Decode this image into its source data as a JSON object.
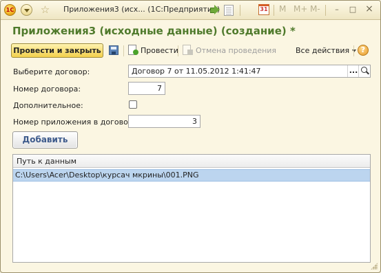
{
  "window": {
    "title": "Приложения3 (исх...  (1С:Предприятие)",
    "logo_text": "1С",
    "calendar_text": "31",
    "memory_buttons": [
      "M",
      "M+",
      "M-"
    ],
    "controls": {
      "minimize": "–",
      "restore": "□",
      "close": "×"
    }
  },
  "form": {
    "title": "Приложения3 (исходные данные) (создание) *"
  },
  "toolbar": {
    "post_and_close": "Провести и закрыть",
    "post": "Провести",
    "cancel_posting": "Отмена проведения",
    "all_actions": "Все действия",
    "help": "?"
  },
  "fields": {
    "contract": {
      "label": "Выберите договор:",
      "value": "Договор 7 от 11.05.2012 1:41:47",
      "select_button": "..."
    },
    "contract_number": {
      "label": "Номер договора:",
      "value": "7"
    },
    "additional": {
      "label": "Дополнительное:",
      "checked": false
    },
    "appendix_number": {
      "label": "Номер приложения в договоре:",
      "value": "3"
    }
  },
  "add_button": "Добавить",
  "table": {
    "columns": [
      "Путь к данным"
    ],
    "rows": [
      {
        "path": "C:\\Users\\Acer\\Desktop\\курсач мкрины\\001.PNG",
        "selected": true
      }
    ]
  }
}
